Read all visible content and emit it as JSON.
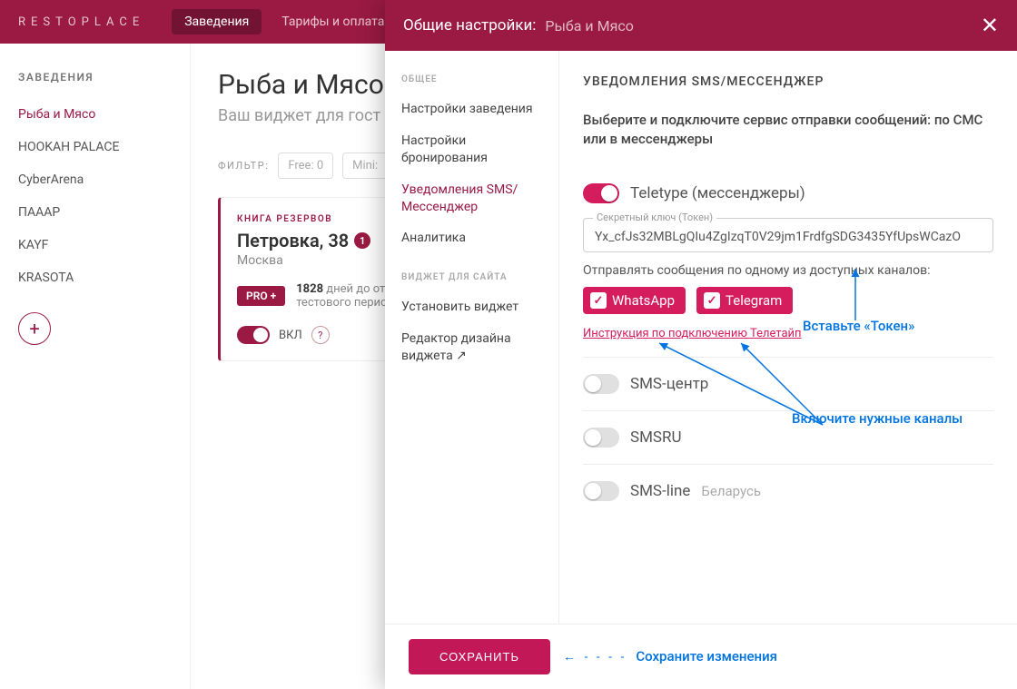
{
  "header": {
    "logo": "RESTOPLACE",
    "nav": {
      "establishments": "Заведения",
      "tariffs": "Тарифы и оплата"
    }
  },
  "sidebar": {
    "heading": "ЗАВЕДЕНИЯ",
    "items": [
      "Рыба и Мясо",
      "HOOKAH PALACE",
      "CyberArena",
      "ПАААР",
      "KAYF",
      "KRASOTA"
    ]
  },
  "page": {
    "title": "Рыба и Мясо",
    "subtitle": "Ваш виджет для гост",
    "filter_label": "ФИЛЬТР:",
    "filter_chips": [
      "Free: 0",
      "Mini:"
    ]
  },
  "card": {
    "tag": "КНИГА РЕЗЕРВОВ",
    "title": "Петровка, 38",
    "badge": "1",
    "city": "Москва",
    "pro": "PRO +",
    "days": "1828",
    "days_text": "дней до от",
    "days_text2": "тестового перио",
    "toggle_label": "ВКЛ",
    "help": "?"
  },
  "modal": {
    "header": {
      "title": "Общие настройки:",
      "sub": "Рыба и Мясо"
    },
    "sidebar": {
      "group1": "ОБЩЕЕ",
      "items1": [
        "Настройки заведения",
        "Настройки бронирования",
        "Уведомления SMS/Мессенджер",
        "Аналитика"
      ],
      "group2": "ВИДЖЕТ ДЛЯ САЙТА",
      "items2": [
        "Установить виджет",
        "Редактор дизайна виджета ↗"
      ]
    },
    "main": {
      "section_title": "УВЕДОМЛЕНИЯ SMS/МЕССЕНДЖЕР",
      "section_desc": "Выберите и подключите сервис отправки сообщений: по СМС или в мессенджеры",
      "providers": {
        "teletype": {
          "name": "Teletype (мессенджеры)",
          "token_label": "Секретный ключ (Токен)",
          "token_value": "Yx_cfJs32MBLgQIu4ZgIzqT0V29jm1FrdfgSDG3435YfUpsWCazO",
          "channels_label": "Отправлять сообщения по одному из доступных каналов:",
          "whatsapp": "WhatsApp",
          "telegram": "Telegram",
          "instruction": "Инструкция по подключению Телетайп"
        },
        "sms_center": "SMS-центр",
        "smsru": "SMSRU",
        "smsline": "SMS-line",
        "smsline_sub": "Беларусь"
      }
    },
    "footer": {
      "save": "СОХРАНИТЬ"
    }
  },
  "annotations": {
    "token": "Вставьте «Токен»",
    "channels": "Включите нужные каналы",
    "save": "Сохраните изменения"
  }
}
